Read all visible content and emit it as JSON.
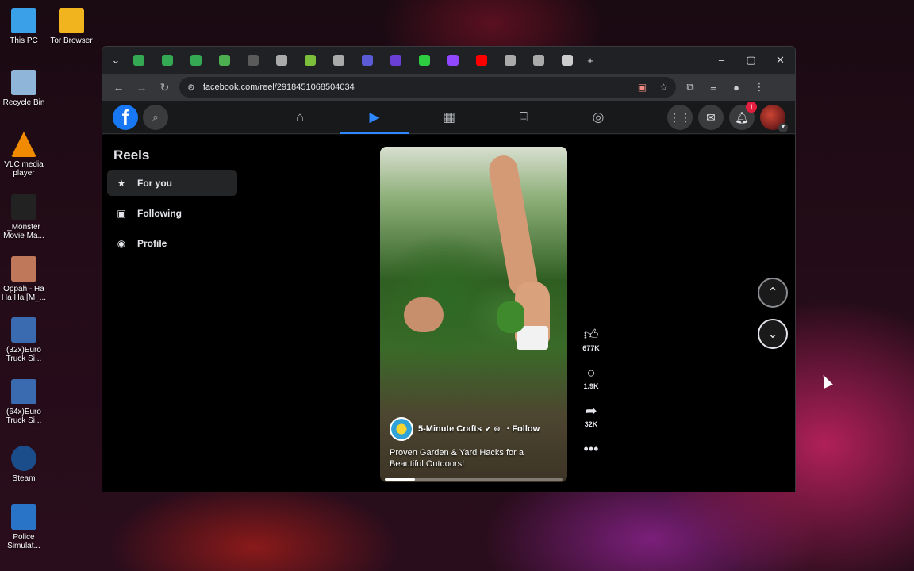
{
  "desktop": {
    "icons": [
      {
        "label": "This PC",
        "color": "#3aa0e8"
      },
      {
        "label": "Tor Browser",
        "color": "#f2b41e"
      },
      {
        "label": "Recycle Bin",
        "color": "#8fb6d8"
      },
      {
        "label": "VLC media player",
        "color": "#f08a00"
      },
      {
        "label": "_Monster Movie Ma...",
        "color": "#222222"
      },
      {
        "label": "Oppah - Ha Ha Ha [M_...",
        "color": "#c0785a"
      },
      {
        "label": "(32x)Euro Truck Si...",
        "color": "#3a6ab0"
      },
      {
        "label": "(64x)Euro Truck Si...",
        "color": "#3a6ab0"
      },
      {
        "label": "Steam",
        "color": "#1b4d8a"
      },
      {
        "label": "Police Simulat...",
        "color": "#2a74c8"
      }
    ]
  },
  "browser": {
    "url": "facebook.com/reel/2918451068504034",
    "tab_icon_colors": [
      "#34a853",
      "#34a853",
      "#34a853",
      "#4caf50",
      "#5a5a5a",
      "#aaaaaa",
      "#7bbf3a",
      "#aaaaaa",
      "#5b5bd6",
      "#6a3fd6",
      "#2ecc40",
      "#9146ff",
      "#ff0000",
      "#aaaaaa",
      "#aaaaaa",
      "#cccccc"
    ],
    "new_tab_label": "+",
    "window_controls": [
      "–",
      "▢",
      "✕"
    ]
  },
  "facebook": {
    "logo_letter": "f",
    "notification_count": "1",
    "sidebar": {
      "title": "Reels",
      "items": [
        {
          "label": "For you",
          "icon": "star-icon",
          "glyph": "★"
        },
        {
          "label": "Following",
          "icon": "following-icon",
          "glyph": "▣"
        },
        {
          "label": "Profile",
          "icon": "profile-icon",
          "glyph": "◉"
        }
      ]
    },
    "reel": {
      "author": "5-Minute Crafts",
      "follow_label": "· Follow",
      "caption": "Proven Garden & Yard Hacks for a Beautiful Outdoors!",
      "progress": 0.17,
      "likes": "677K",
      "comments": "1.9K",
      "shares": "32K"
    }
  }
}
